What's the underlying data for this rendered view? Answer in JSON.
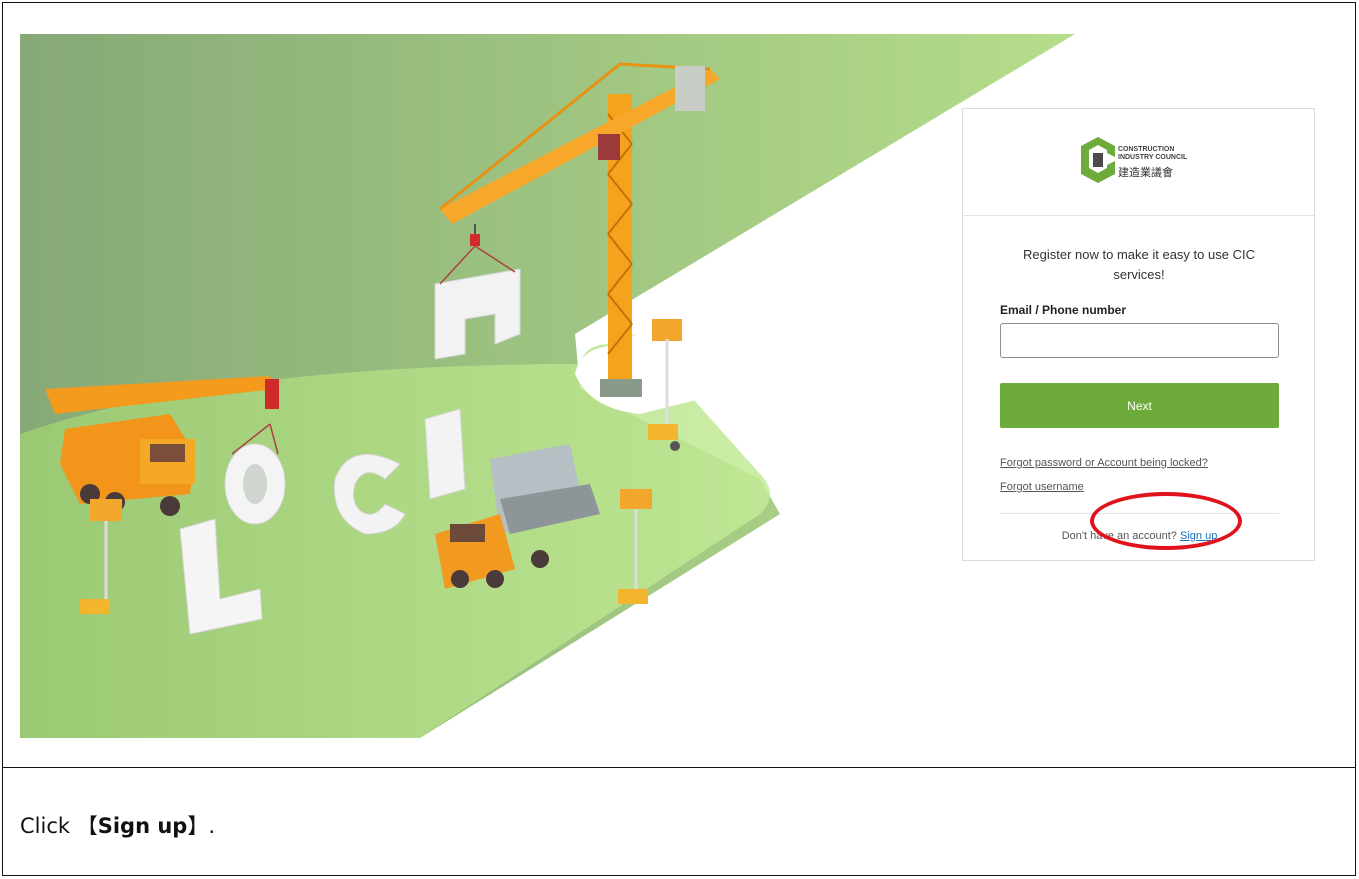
{
  "login_card": {
    "logo": {
      "line1": "CONSTRUCTION",
      "line2": "INDUSTRY COUNCIL",
      "chinese": "建造業議會"
    },
    "intro_text": "Register now to make it easy to use CIC services!",
    "email_label": "Email / Phone number",
    "email_value": "",
    "next_button": "Next",
    "forgot_password_link": "Forgot password or Account being locked?",
    "forgot_username_link": "Forgot username",
    "no_account_text": "Don't have an account?",
    "signup_link": "Sign up"
  },
  "instruction": {
    "prefix": "Click ",
    "open_bracket": "【",
    "target": "Sign up",
    "close_bracket": "】."
  },
  "colors": {
    "accent_green": "#6dac3a",
    "link_blue": "#1a6fb7",
    "highlight_red": "#e0121b"
  }
}
